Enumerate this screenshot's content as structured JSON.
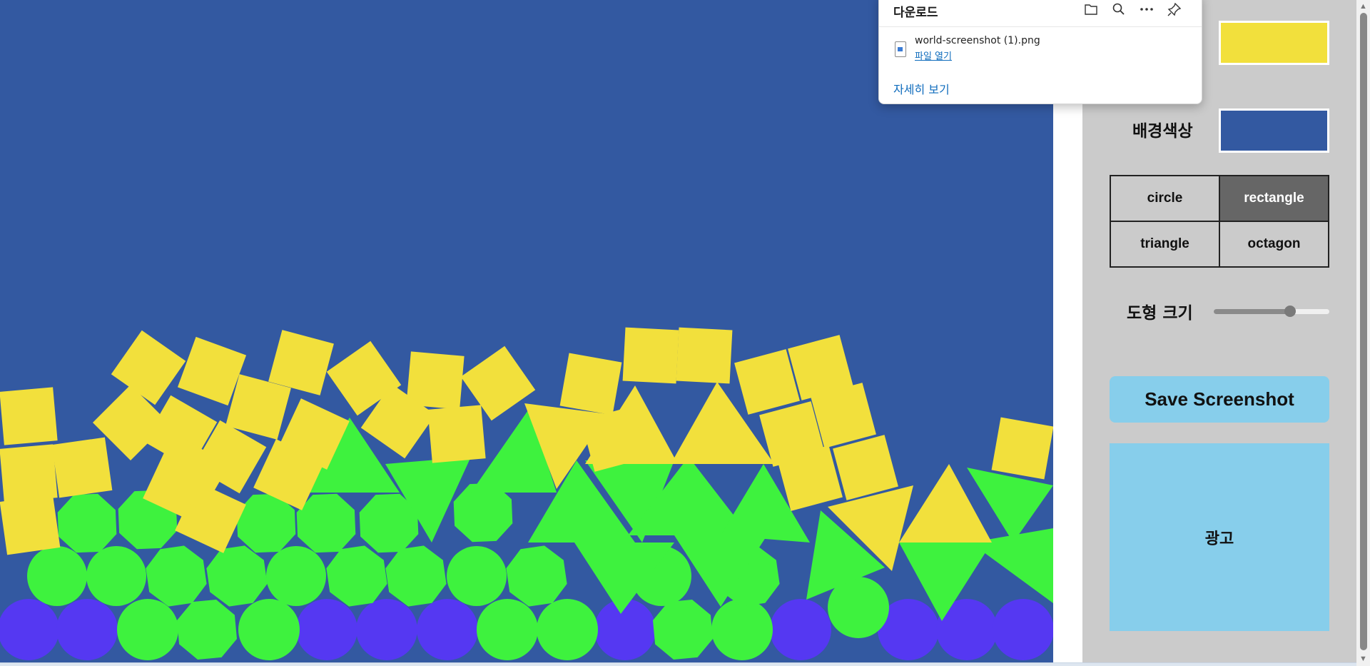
{
  "colors": {
    "background": "#3359a1",
    "shape_color": "#f2e03c",
    "green_shapes": "#3ef23e",
    "purple_shapes": "#5538f2",
    "panel": "#cbcbcb",
    "selected_button": "#666666",
    "save_button": "#87ceeb",
    "link": "#0f6cbd"
  },
  "downloads_popup": {
    "title": "다운로드",
    "icons": [
      "folder-icon",
      "search-icon",
      "more-options-icon",
      "pin-icon"
    ],
    "file_name": "world-screenshot (1).png",
    "open_file": "파일 열기",
    "see_more": "자세히 보기"
  },
  "panel": {
    "shape_color_swatch": "#f2e03c",
    "background_label": "배경색상",
    "background_swatch": "#3359a1",
    "shape_buttons": [
      {
        "label": "circle",
        "selected": false
      },
      {
        "label": "rectangle",
        "selected": true
      },
      {
        "label": "triangle",
        "selected": false
      },
      {
        "label": "octagon",
        "selected": false
      }
    ],
    "size_label": "도형 크기",
    "size_slider_fraction": 0.66,
    "save_label": "Save Screenshot",
    "ad_label": "광고"
  }
}
